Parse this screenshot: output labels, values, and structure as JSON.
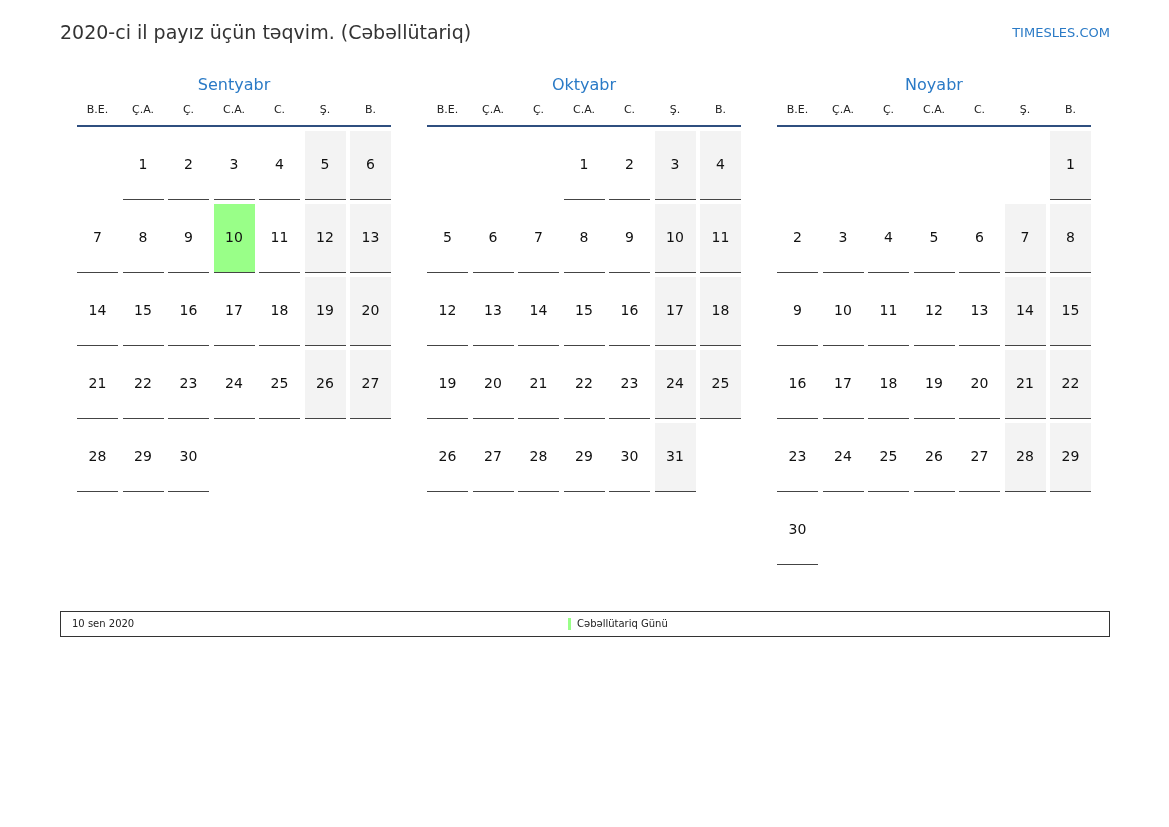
{
  "title": "2020-ci il payız üçün təqvim. (Cəbəllütariq)",
  "site": "TIMESLES.COM",
  "months": [
    {
      "name": "Sentyabr",
      "weekdays": [
        "B.E.",
        "Ç.A.",
        "Ç.",
        "C.A.",
        "C.",
        "Ş.",
        "B."
      ],
      "weeks": [
        [
          {
            "day": "1",
            "weekend": false,
            "holiday": false
          },
          {
            "day": "2",
            "weekend": false,
            "holiday": false
          },
          {
            "day": "3",
            "weekend": false,
            "holiday": false
          },
          {
            "day": "4",
            "weekend": false,
            "holiday": false
          },
          {
            "day": "5",
            "weekend": true,
            "holiday": false
          },
          {
            "day": "6",
            "weekend": true,
            "holiday": false
          }
        ],
        [
          {
            "day": "7",
            "weekend": false,
            "holiday": false
          },
          {
            "day": "8",
            "weekend": false,
            "holiday": false
          },
          {
            "day": "9",
            "weekend": false,
            "holiday": false
          },
          {
            "day": "10",
            "weekend": false,
            "holiday": true
          },
          {
            "day": "11",
            "weekend": false,
            "holiday": false
          },
          {
            "day": "12",
            "weekend": true,
            "holiday": false
          },
          {
            "day": "13",
            "weekend": true,
            "holiday": false
          }
        ],
        [
          {
            "day": "14",
            "weekend": false,
            "holiday": false
          },
          {
            "day": "15",
            "weekend": false,
            "holiday": false
          },
          {
            "day": "16",
            "weekend": false,
            "holiday": false
          },
          {
            "day": "17",
            "weekend": false,
            "holiday": false
          },
          {
            "day": "18",
            "weekend": false,
            "holiday": false
          },
          {
            "day": "19",
            "weekend": true,
            "holiday": false
          },
          {
            "day": "20",
            "weekend": true,
            "holiday": false
          }
        ],
        [
          {
            "day": "21",
            "weekend": false,
            "holiday": false
          },
          {
            "day": "22",
            "weekend": false,
            "holiday": false
          },
          {
            "day": "23",
            "weekend": false,
            "holiday": false
          },
          {
            "day": "24",
            "weekend": false,
            "holiday": false
          },
          {
            "day": "25",
            "weekend": false,
            "holiday": false
          },
          {
            "day": "26",
            "weekend": true,
            "holiday": false
          },
          {
            "day": "27",
            "weekend": true,
            "holiday": false
          }
        ],
        [
          {
            "day": "28",
            "weekend": false,
            "holiday": false
          },
          {
            "day": "29",
            "weekend": false,
            "holiday": false
          },
          {
            "day": "30",
            "weekend": false,
            "holiday": false
          }
        ]
      ]
    },
    {
      "name": "Oktyabr",
      "weekdays": [
        "B.E.",
        "Ç.A.",
        "Ç.",
        "C.A.",
        "C.",
        "Ş.",
        "B."
      ],
      "weeks": [
        [
          {
            "day": "1",
            "weekend": false,
            "holiday": false
          },
          {
            "day": "2",
            "weekend": false,
            "holiday": false
          },
          {
            "day": "3",
            "weekend": true,
            "holiday": false
          },
          {
            "day": "4",
            "weekend": true,
            "holiday": false
          }
        ],
        [
          {
            "day": "5",
            "weekend": false,
            "holiday": false
          },
          {
            "day": "6",
            "weekend": false,
            "holiday": false
          },
          {
            "day": "7",
            "weekend": false,
            "holiday": false
          },
          {
            "day": "8",
            "weekend": false,
            "holiday": false
          },
          {
            "day": "9",
            "weekend": false,
            "holiday": false
          },
          {
            "day": "10",
            "weekend": true,
            "holiday": false
          },
          {
            "day": "11",
            "weekend": true,
            "holiday": false
          }
        ],
        [
          {
            "day": "12",
            "weekend": false,
            "holiday": false
          },
          {
            "day": "13",
            "weekend": false,
            "holiday": false
          },
          {
            "day": "14",
            "weekend": false,
            "holiday": false
          },
          {
            "day": "15",
            "weekend": false,
            "holiday": false
          },
          {
            "day": "16",
            "weekend": false,
            "holiday": false
          },
          {
            "day": "17",
            "weekend": true,
            "holiday": false
          },
          {
            "day": "18",
            "weekend": true,
            "holiday": false
          }
        ],
        [
          {
            "day": "19",
            "weekend": false,
            "holiday": false
          },
          {
            "day": "20",
            "weekend": false,
            "holiday": false
          },
          {
            "day": "21",
            "weekend": false,
            "holiday": false
          },
          {
            "day": "22",
            "weekend": false,
            "holiday": false
          },
          {
            "day": "23",
            "weekend": false,
            "holiday": false
          },
          {
            "day": "24",
            "weekend": true,
            "holiday": false
          },
          {
            "day": "25",
            "weekend": true,
            "holiday": false
          }
        ],
        [
          {
            "day": "26",
            "weekend": false,
            "holiday": false
          },
          {
            "day": "27",
            "weekend": false,
            "holiday": false
          },
          {
            "day": "28",
            "weekend": false,
            "holiday": false
          },
          {
            "day": "29",
            "weekend": false,
            "holiday": false
          },
          {
            "day": "30",
            "weekend": false,
            "holiday": false
          },
          {
            "day": "31",
            "weekend": true,
            "holiday": false
          }
        ]
      ]
    },
    {
      "name": "Noyabr",
      "weekdays": [
        "B.E.",
        "Ç.A.",
        "Ç.",
        "C.A.",
        "C.",
        "Ş.",
        "B."
      ],
      "weeks": [
        [
          {
            "day": "1",
            "weekend": true,
            "holiday": false
          }
        ],
        [
          {
            "day": "2",
            "weekend": false,
            "holiday": false
          },
          {
            "day": "3",
            "weekend": false,
            "holiday": false
          },
          {
            "day": "4",
            "weekend": false,
            "holiday": false
          },
          {
            "day": "5",
            "weekend": false,
            "holiday": false
          },
          {
            "day": "6",
            "weekend": false,
            "holiday": false
          },
          {
            "day": "7",
            "weekend": true,
            "holiday": false
          },
          {
            "day": "8",
            "weekend": true,
            "holiday": false
          }
        ],
        [
          {
            "day": "9",
            "weekend": false,
            "holiday": false
          },
          {
            "day": "10",
            "weekend": false,
            "holiday": false
          },
          {
            "day": "11",
            "weekend": false,
            "holiday": false
          },
          {
            "day": "12",
            "weekend": false,
            "holiday": false
          },
          {
            "day": "13",
            "weekend": false,
            "holiday": false
          },
          {
            "day": "14",
            "weekend": true,
            "holiday": false
          },
          {
            "day": "15",
            "weekend": true,
            "holiday": false
          }
        ],
        [
          {
            "day": "16",
            "weekend": false,
            "holiday": false
          },
          {
            "day": "17",
            "weekend": false,
            "holiday": false
          },
          {
            "day": "18",
            "weekend": false,
            "holiday": false
          },
          {
            "day": "19",
            "weekend": false,
            "holiday": false
          },
          {
            "day": "20",
            "weekend": false,
            "holiday": false
          },
          {
            "day": "21",
            "weekend": true,
            "holiday": false
          },
          {
            "day": "22",
            "weekend": true,
            "holiday": false
          }
        ],
        [
          {
            "day": "23",
            "weekend": false,
            "holiday": false
          },
          {
            "day": "24",
            "weekend": false,
            "holiday": false
          },
          {
            "day": "25",
            "weekend": false,
            "holiday": false
          },
          {
            "day": "26",
            "weekend": false,
            "holiday": false
          },
          {
            "day": "27",
            "weekend": false,
            "holiday": false
          },
          {
            "day": "28",
            "weekend": true,
            "holiday": false
          },
          {
            "day": "29",
            "weekend": true,
            "holiday": false
          }
        ],
        [
          {
            "day": "30",
            "weekend": false,
            "holiday": false
          }
        ]
      ]
    }
  ],
  "legend": [
    {
      "date": "10 sen 2020",
      "name": "Cəbəllütariq Günü",
      "color": "#99ff88"
    }
  ]
}
